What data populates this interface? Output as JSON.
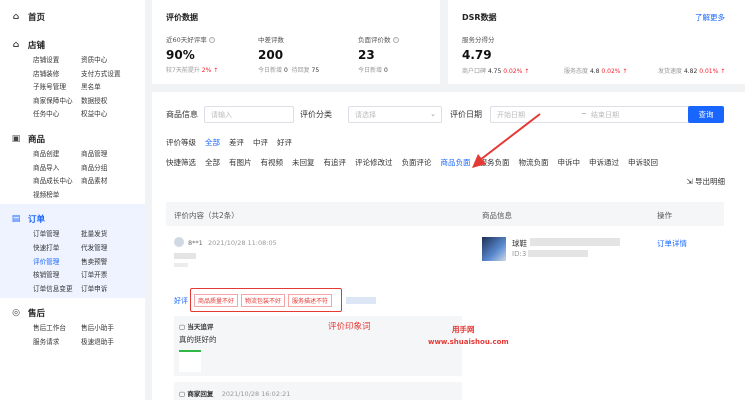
{
  "sidebar": {
    "home": {
      "label": "首页"
    },
    "sections": [
      {
        "title": "店铺",
        "items": [
          "店铺设置",
          "资质中心",
          "店铺装修",
          "支付方式设置",
          "子账号管理",
          "黑名单",
          "商家保障中心",
          "数据授权",
          "任务中心",
          "权益中心"
        ]
      },
      {
        "title": "商品",
        "items": [
          "商品创建",
          "商品管理",
          "商品导入",
          "商品分组",
          "商品成长中心",
          "商品素材",
          "视频榜单"
        ]
      },
      {
        "title": "订单",
        "items": [
          "订单管理",
          "批量发货",
          "快速打单",
          "代发管理",
          "评价管理",
          "售卖预警",
          "核销管理",
          "订单开票",
          "订单信息变更",
          "订单申诉"
        ]
      },
      {
        "title": "售后",
        "items": [
          "售后工作台",
          "售后小助手",
          "服务请求",
          "极速退助手"
        ]
      }
    ]
  },
  "review_stats": {
    "title": "评价数据",
    "good_rate": {
      "label": "近60天好评率",
      "value": "90%",
      "sub_label": "较7天前提升",
      "sub_value": "2%"
    },
    "mid_bad": {
      "label": "中差评数",
      "value": "200",
      "sub_label": "今日新增",
      "sub_value": "0",
      "sub_label2": "待回复",
      "sub_value2": "75"
    },
    "negative": {
      "label": "负面评价数",
      "value": "23",
      "sub_label": "今日新增",
      "sub_value": "0"
    }
  },
  "dsr": {
    "title": "DSR数据",
    "link": "了解更多",
    "score_label": "服务分得分",
    "score": "4.79",
    "items": [
      {
        "label": "商户口碑",
        "value": "4.75",
        "delta": "0.02%"
      },
      {
        "label": "服务态度",
        "value": "4.8",
        "delta": "0.02%"
      },
      {
        "label": "发货速度",
        "value": "4.82",
        "delta": "0.01%"
      }
    ]
  },
  "filters": {
    "product_info": {
      "label": "商品信息",
      "placeholder": "请输入"
    },
    "review_category": {
      "label": "评价分类",
      "placeholder": "请选择"
    },
    "review_date": {
      "label": "评价日期",
      "start": "开始日期",
      "sep": "~",
      "end": "结束日期"
    },
    "query_button": "查询",
    "level": {
      "label": "评价等级",
      "options": [
        "全部",
        "差评",
        "中评",
        "好评"
      ]
    },
    "quick": {
      "label": "快捷筛选",
      "options": [
        "全部",
        "有图片",
        "有视频",
        "未回复",
        "有追评",
        "评论修改过",
        "负面评论",
        "商品负面",
        "服务负面",
        "物流负面",
        "申诉中",
        "申诉通过",
        "申诉驳回"
      ]
    },
    "export": "导出明细"
  },
  "table": {
    "headers": {
      "content": "评价内容（共2条）",
      "product": "商品信息",
      "action": "操作"
    },
    "row": {
      "user": "8**1",
      "time": "2021/10/28 11:08:05",
      "product_name": "球鞋",
      "product_id": "ID:3",
      "action": "订单详情",
      "good_label": "好评",
      "tags": [
        "商品质量不好",
        "物流包装不好",
        "服务描述不符"
      ],
      "followup_title": "当天追评",
      "followup_text": "真的挺好的",
      "reply_title": "商家回复",
      "reply_time": "2021/10/28 16:02:21"
    }
  },
  "annotations": {
    "impression": "评价印象词",
    "watermark1": "用手网",
    "watermark2": "www.shuaishou.com"
  }
}
